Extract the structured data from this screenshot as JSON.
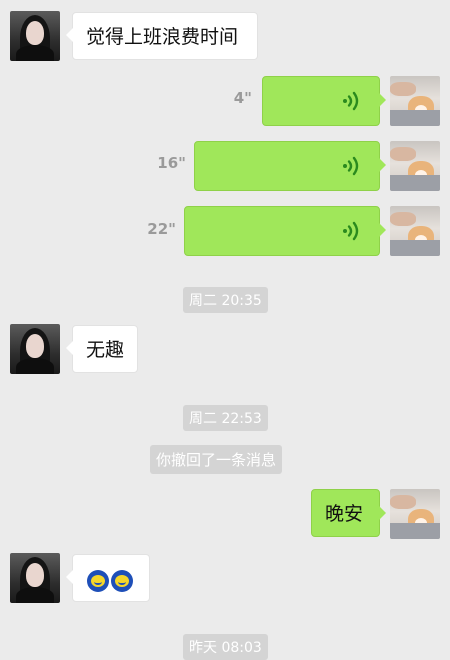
{
  "messages": [
    {
      "side": "left",
      "type": "text",
      "text": "觉得上班浪费时间"
    },
    {
      "side": "right",
      "type": "voice",
      "duration": "4\""
    },
    {
      "side": "right",
      "type": "voice",
      "duration": "16\""
    },
    {
      "side": "right",
      "type": "voice",
      "duration": "22\""
    },
    {
      "type": "timestamp",
      "text": "周二 20:35"
    },
    {
      "side": "left",
      "type": "text",
      "text": "无趣"
    },
    {
      "type": "timestamp",
      "text": "周二 22:53"
    },
    {
      "type": "system",
      "text": "你撤回了一条消息"
    },
    {
      "side": "right",
      "type": "text",
      "text": "晚安"
    },
    {
      "side": "left",
      "type": "emoji",
      "emoji": [
        "smile-emoji",
        "smile-emoji"
      ]
    },
    {
      "type": "timestamp",
      "text": "昨天 08:03"
    }
  ],
  "colors": {
    "background": "#ebebeb",
    "bubble_out": "#a0e75a",
    "bubble_in": "#ffffff",
    "voice_icon": "#2a8a1e",
    "timestamp_bg": "#d4d4d4"
  }
}
